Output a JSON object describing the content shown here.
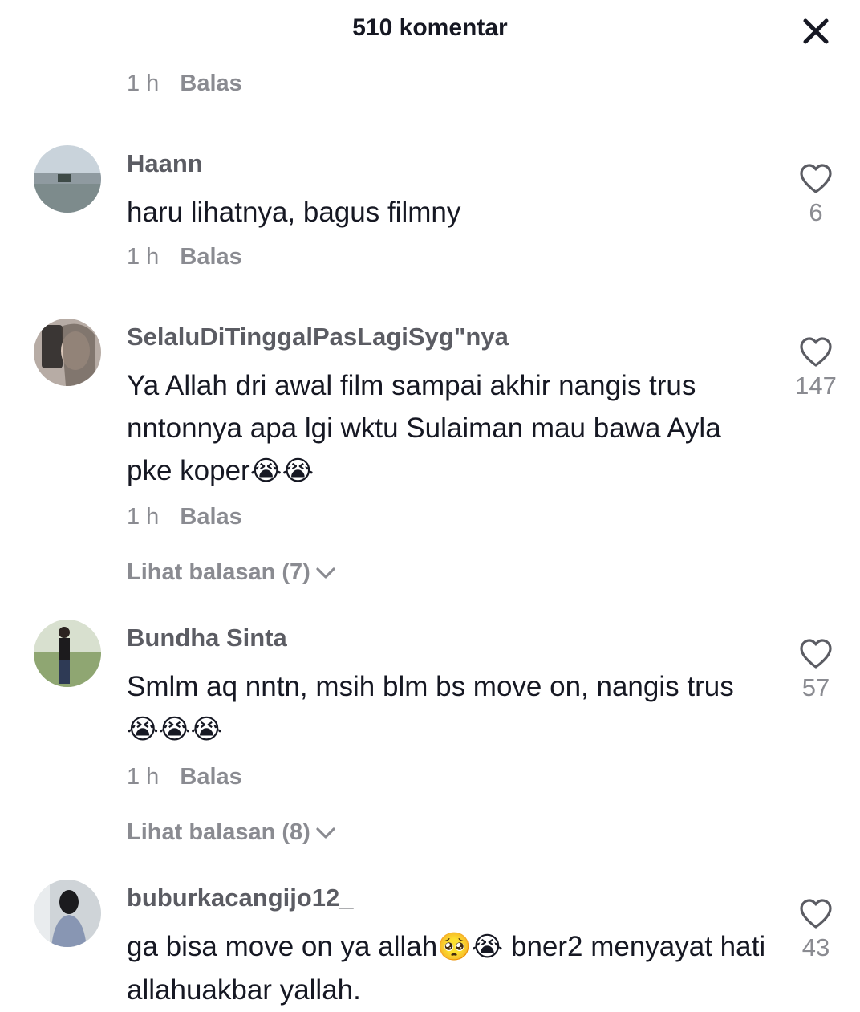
{
  "header": {
    "title": "510 komentar",
    "close_icon": "close-icon"
  },
  "top_meta": {
    "time": "1 h",
    "reply": "Balas"
  },
  "comments": [
    {
      "username": "Haann",
      "text": "haru lihatnya, bagus filmny",
      "emoji": "",
      "time": "1 h",
      "reply": "Balas",
      "likes": "6",
      "view_replies": ""
    },
    {
      "username": "SelaluDiTinggalPasLagiSyg\"nya",
      "text": "Ya Allah dri awal film sampai akhir nangis trus nntonnya apa lgi wktu Sulaiman mau bawa Ayla pke koper",
      "emoji": "😭😭",
      "time": "1 h",
      "reply": "Balas",
      "likes": "147",
      "view_replies": "Lihat balasan (7)"
    },
    {
      "username": "Bundha Sinta",
      "text": "Smlm aq nntn, msih blm bs move on, nangis trus ",
      "emoji": "😭😭😭",
      "time": "1 h",
      "reply": "Balas",
      "likes": "57",
      "view_replies": "Lihat balasan (8)"
    },
    {
      "username": "buburkacangijo12_",
      "text_before": "ga bisa move on ya allah",
      "emoji": "🥺😭",
      "text_after": " bner2 menyayat hati allahuakbar yallah.",
      "likes": "43"
    }
  ]
}
